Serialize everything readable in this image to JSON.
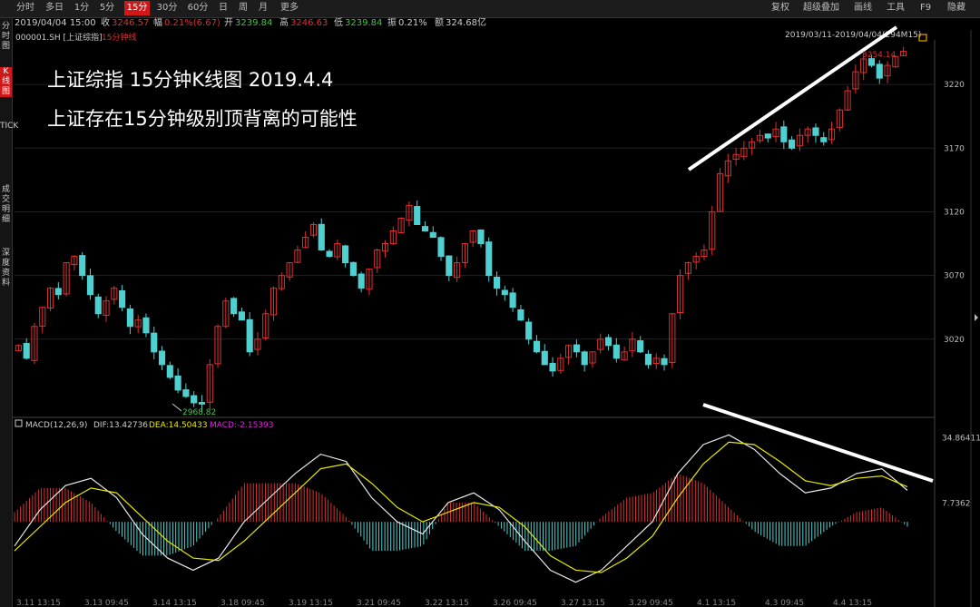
{
  "toolbar": {
    "tabs": [
      "分时",
      "多日",
      "1分",
      "5分",
      "15分",
      "30分",
      "60分",
      "日",
      "周",
      "月",
      "更多"
    ],
    "active_tab": "15分",
    "right_items": [
      "复权",
      "超级叠加",
      "画线",
      "工具",
      "F9",
      "隐藏"
    ]
  },
  "info": {
    "datetime": "2019/04/04 15:00",
    "close_label": "收",
    "close": "3246.57",
    "change_label": "幅",
    "change": "0.21%(6.67)",
    "open_label": "开",
    "open": "3239.84",
    "high_label": "高",
    "high": "3246.63",
    "low_label": "低",
    "low": "3239.84",
    "amp_label": "振",
    "amp": "0.21%",
    "amount_label": "额",
    "amount": "324.68亿"
  },
  "sidebar": {
    "items": [
      "分时图",
      "K线图",
      "TICK",
      "成交明细",
      "深度资料"
    ]
  },
  "chart_header": {
    "code": "000001.SH [上证综指]",
    "period": "15分钟线",
    "range": "2019/03/11-2019/04/04(294M15)"
  },
  "overlay": {
    "line1": "上证综指  15分钟K线图   2019.4.4",
    "line2": "上证存在15分钟级别顶背离的可能性"
  },
  "macd_header": {
    "name": "MACD(12,26,9)",
    "dif": "DIF:13.42736",
    "dea": "DEA:14.50433",
    "macd": "MACD:-2.15393"
  },
  "colors": {
    "up": "#e03030",
    "down": "#4fd0d0",
    "dif": "#e8e8e8",
    "dea": "#e8e800",
    "macd": "#e020e0",
    "accent": "#d01818"
  },
  "chart_data": [
    {
      "type": "candlestick",
      "title": "上证综指 15分钟线",
      "y_ticks": [
        3020,
        3070,
        3120,
        3170,
        3220
      ],
      "ylim": [
        2960,
        3255
      ],
      "low_label": "2968.82",
      "high_label": "3254.14",
      "close_series": [
        3015,
        3005,
        3030,
        3045,
        3060,
        3055,
        3080,
        3085,
        3070,
        3055,
        3040,
        3050,
        3060,
        3045,
        3030,
        3035,
        3025,
        3010,
        3000,
        2990,
        2980,
        2975,
        2970,
        2969,
        3000,
        3030,
        3050,
        3040,
        3035,
        3010,
        3020,
        3040,
        3060,
        3070,
        3080,
        3090,
        3100,
        3110,
        3090,
        3085,
        3095,
        3080,
        3070,
        3060,
        3075,
        3090,
        3095,
        3105,
        3115,
        3125,
        3110,
        3105,
        3100,
        3085,
        3070,
        3080,
        3095,
        3105,
        3095,
        3070,
        3060,
        3055,
        3045,
        3035,
        3020,
        3010,
        3000,
        2995,
        3005,
        3015,
        3010,
        3000,
        3010,
        3020,
        3015,
        3005,
        3010,
        3020,
        3010,
        3000,
        3005,
        3000,
        3040,
        3070,
        3080,
        3085,
        3090,
        3120,
        3150,
        3160,
        3165,
        3170,
        3175,
        3180,
        3178,
        3185,
        3175,
        3170,
        3180,
        3185,
        3180,
        3175,
        3185,
        3200,
        3215,
        3230,
        3240,
        3235,
        3225,
        3235,
        3242,
        3246
      ],
      "x_ticks": [
        "3.11 13:15",
        "3.13 09:45",
        "3.14 13:15",
        "3.18 09:45",
        "3.19 13:15",
        "3.21 09:45",
        "3.22 13:15",
        "3.26 09:45",
        "3.27 13:15",
        "3.29 09:45",
        "4.1 13:15",
        "4.3 09:45",
        "4.4 13:15"
      ]
    },
    {
      "type": "line",
      "title": "MACD(12,26,9)",
      "y_ticks": [
        34.86411,
        7.7362
      ],
      "ylim": [
        -30,
        38
      ],
      "series": [
        {
          "name": "DIF",
          "values": [
            -10,
            5,
            15,
            18,
            10,
            -5,
            -15,
            -20,
            -15,
            0,
            10,
            20,
            28,
            25,
            10,
            0,
            -5,
            8,
            12,
            5,
            -8,
            -20,
            -25,
            -20,
            -10,
            0,
            20,
            32,
            36,
            30,
            20,
            12,
            14,
            20,
            22,
            13
          ]
        },
        {
          "name": "DEA",
          "values": [
            -12,
            -2,
            8,
            14,
            12,
            2,
            -8,
            -15,
            -16,
            -8,
            2,
            12,
            22,
            24,
            16,
            6,
            0,
            4,
            8,
            6,
            -2,
            -14,
            -20,
            -21,
            -15,
            -6,
            10,
            24,
            33,
            32,
            25,
            17,
            15,
            18,
            19,
            14.5
          ]
        },
        {
          "name": "MACD",
          "values": [
            4,
            14,
            14,
            8,
            -4,
            -14,
            -14,
            -10,
            2,
            16,
            16,
            16,
            12,
            2,
            -12,
            -12,
            -10,
            8,
            8,
            -2,
            -12,
            -12,
            -10,
            2,
            10,
            12,
            20,
            16,
            6,
            -4,
            -10,
            -10,
            -2,
            4,
            6,
            -2
          ]
        }
      ]
    }
  ]
}
